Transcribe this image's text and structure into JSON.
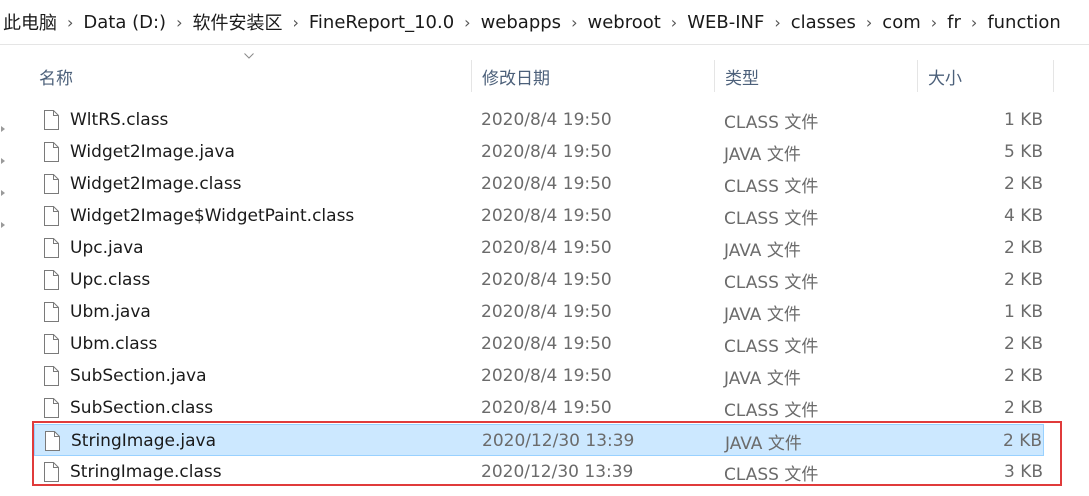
{
  "breadcrumb": [
    "此电脑",
    "Data (D:)",
    "软件安装区",
    "FineReport_10.0",
    "webapps",
    "webroot",
    "WEB-INF",
    "classes",
    "com",
    "fr",
    "function"
  ],
  "columns": {
    "name": "名称",
    "date": "修改日期",
    "type": "类型",
    "size": "大小"
  },
  "files": [
    {
      "name": "WltRS.class",
      "date": "2020/8/4 19:50",
      "type": "CLASS 文件",
      "size": "1 KB"
    },
    {
      "name": "Widget2Image.java",
      "date": "2020/8/4 19:50",
      "type": "JAVA 文件",
      "size": "5 KB"
    },
    {
      "name": "Widget2Image.class",
      "date": "2020/8/4 19:50",
      "type": "CLASS 文件",
      "size": "2 KB"
    },
    {
      "name": "Widget2Image$WidgetPaint.class",
      "date": "2020/8/4 19:50",
      "type": "CLASS 文件",
      "size": "4 KB"
    },
    {
      "name": "Upc.java",
      "date": "2020/8/4 19:50",
      "type": "JAVA 文件",
      "size": "2 KB"
    },
    {
      "name": "Upc.class",
      "date": "2020/8/4 19:50",
      "type": "CLASS 文件",
      "size": "2 KB"
    },
    {
      "name": "Ubm.java",
      "date": "2020/8/4 19:50",
      "type": "JAVA 文件",
      "size": "1 KB"
    },
    {
      "name": "Ubm.class",
      "date": "2020/8/4 19:50",
      "type": "CLASS 文件",
      "size": "2 KB"
    },
    {
      "name": "SubSection.java",
      "date": "2020/8/4 19:50",
      "type": "JAVA 文件",
      "size": "2 KB"
    },
    {
      "name": "SubSection.class",
      "date": "2020/8/4 19:50",
      "type": "CLASS 文件",
      "size": "2 KB"
    },
    {
      "name": "StringImage.java",
      "date": "2020/12/30 13:39",
      "type": "JAVA 文件",
      "size": "2 KB",
      "selected": true
    },
    {
      "name": "StringImage.class",
      "date": "2020/12/30 13:39",
      "type": "CLASS 文件",
      "size": "3 KB"
    }
  ],
  "colors": {
    "selection_bg": "#cce8ff",
    "selection_border": "#99d1ff",
    "highlight_box": "#e03b3b",
    "header_text": "#4c607a"
  }
}
